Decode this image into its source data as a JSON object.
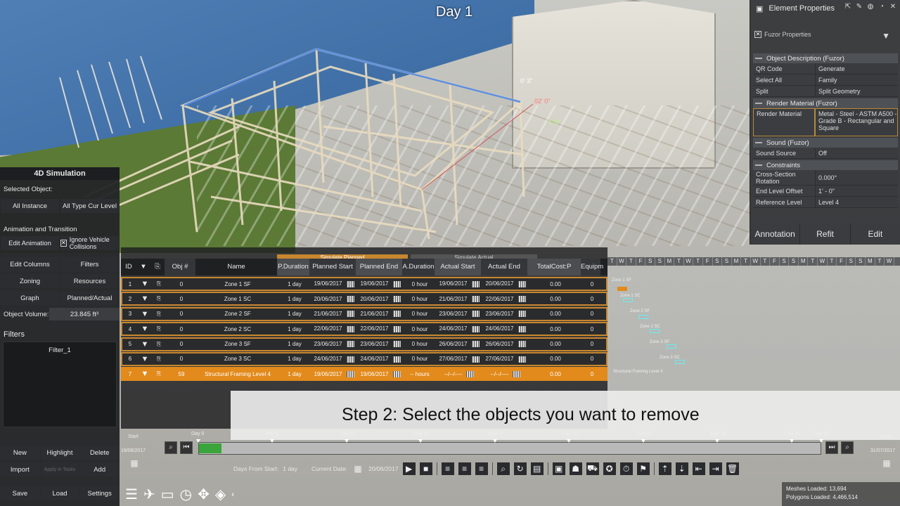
{
  "viewport": {
    "day_label": "Day 1",
    "dims": [
      "0' 3\"",
      "02' 0\"",
      "1' 0\""
    ]
  },
  "props": {
    "title": "Element Properties",
    "fuzor_label": "Fuzor Properties",
    "sections": [
      {
        "title": "Object Description (Fuzor)",
        "rows": [
          {
            "k": "QR Code",
            "v": "Generate"
          },
          {
            "k": "Select All",
            "v": "Family"
          },
          {
            "k": "Split",
            "v": "Split Geometry"
          }
        ]
      },
      {
        "title": "Render Material (Fuzor)",
        "rows": [
          {
            "k": "Render Material",
            "v": "Metal - Steel - ASTM A500 - Grade B - Rectangular and Square"
          }
        ]
      },
      {
        "title": "Sound (Fuzor)",
        "rows": [
          {
            "k": "Sound Source",
            "v": "Off"
          }
        ]
      },
      {
        "title": "Constraints",
        "rows": [
          {
            "k": "Cross-Section Rotation",
            "v": "0.000°"
          },
          {
            "k": "End Level Offset",
            "v": "1' - 0\""
          },
          {
            "k": "Reference Level",
            "v": "Level 4"
          }
        ]
      }
    ],
    "buttons": {
      "annotation": "Annotation",
      "refit": "Refit",
      "edit": "Edit"
    }
  },
  "sim": {
    "title": "4D Simulation",
    "selected_object": "Selected Object:",
    "all_instance": "All Instance",
    "all_type": "All Type Cur Level",
    "anim_transition": "Animation and Transition",
    "edit_animation": "Edit Animation",
    "ignore_vehicle": "Ignore Vehicle Collisions",
    "edit_columns": "Edit Columns",
    "filters_btn": "Filters",
    "zoning": "Zoning",
    "resources": "Resources",
    "graph": "Graph",
    "planned_actual": "Planned/Actual",
    "object_volume_label": "Object Volume:",
    "object_volume_value": "23.845 ft³",
    "filters_heading": "Filters",
    "filter_items": [
      "Filter_1"
    ],
    "new": "New",
    "highlight": "Highlight",
    "delete": "Delete",
    "import": "Import",
    "apply_in_tasks": "Apply in Tasks",
    "add": "Add",
    "save": "Save",
    "load": "Load",
    "settings": "Settings"
  },
  "schedule": {
    "group_planned": "Simulate Planned",
    "group_actual": "Simulate Actual",
    "columns": {
      "id": "ID",
      "obj": "Obj #",
      "name": "Name",
      "p_duration": "P.Duration",
      "planned_start": "Planned Start",
      "planned_end": "Planned End",
      "a_duration": "A.Duration",
      "actual_start": "Actual Start",
      "actual_end": "Actual End",
      "total_cost": "TotalCost:P",
      "equip": "Equipm"
    },
    "rows": [
      {
        "id": "1",
        "obj": "0",
        "name": "Zone 1 SF",
        "pdur": "1 day",
        "ps": "19/06/2017",
        "pe": "19/06/2017",
        "adur": "0 hour",
        "as": "19/06/2017",
        "ae": "20/06/2017",
        "cost": "0.00",
        "eq": "0"
      },
      {
        "id": "2",
        "obj": "0",
        "name": "Zone 1 SC",
        "pdur": "1 day",
        "ps": "20/06/2017",
        "pe": "20/06/2017",
        "adur": "0 hour",
        "as": "21/06/2017",
        "ae": "22/06/2017",
        "cost": "0.00",
        "eq": "0"
      },
      {
        "id": "3",
        "obj": "0",
        "name": "Zone 2 SF",
        "pdur": "1 day",
        "ps": "21/06/2017",
        "pe": "21/06/2017",
        "adur": "0 hour",
        "as": "23/06/2017",
        "ae": "23/06/2017",
        "cost": "0.00",
        "eq": "0"
      },
      {
        "id": "4",
        "obj": "0",
        "name": "Zone 2 SC",
        "pdur": "1 day",
        "ps": "22/06/2017",
        "pe": "22/06/2017",
        "adur": "0 hour",
        "as": "24/06/2017",
        "ae": "24/06/2017",
        "cost": "0.00",
        "eq": "0"
      },
      {
        "id": "5",
        "obj": "0",
        "name": "Zone 3 SF",
        "pdur": "1 day",
        "ps": "23/06/2017",
        "pe": "23/06/2017",
        "adur": "0 hour",
        "as": "26/06/2017",
        "ae": "26/06/2017",
        "cost": "0.00",
        "eq": "0"
      },
      {
        "id": "6",
        "obj": "0",
        "name": "Zone 3 SC",
        "pdur": "1 day",
        "ps": "24/06/2017",
        "pe": "24/06/2017",
        "adur": "0 hour",
        "as": "27/06/2017",
        "ae": "27/06/2017",
        "cost": "0.00",
        "eq": "0"
      },
      {
        "id": "7",
        "obj": "59",
        "name": "Structural Framing Level 4",
        "pdur": "1 day",
        "ps": "19/06/2017",
        "pe": "19/06/2017",
        "adur": "-- hours",
        "as": "--/--/----",
        "ae": "--/--/----",
        "cost": "0.00",
        "eq": "0"
      }
    ]
  },
  "gantt": {
    "days": [
      "T",
      "W",
      "T",
      "F",
      "S",
      "S",
      "M",
      "T",
      "W",
      "T",
      "F",
      "S",
      "S",
      "M",
      "T",
      "W",
      "T",
      "F",
      "S",
      "S",
      "M",
      "T",
      "W",
      "T",
      "F",
      "S",
      "S",
      "M",
      "T",
      "W"
    ],
    "labels": [
      "Zone 1 SF",
      "Zone 1 SC",
      "Zone 2 SF",
      "Zone 2 SC",
      "Zone 3 SF",
      "Zone 3 SC",
      "Structural Framing Level 4"
    ]
  },
  "caption": "Step 2: Select the objects you want to remove",
  "timeline": {
    "start_label": "Start",
    "finish_label": "Finish",
    "start_date": "19/06/2017",
    "end_date": "31/07/2017",
    "ticks": [
      "Day 0",
      "Day 5",
      "Day 10",
      "Day 15",
      "Day 20",
      "Day 25",
      "Day 30",
      "Day 35",
      "Day 40",
      "Day 42"
    ],
    "progress": 0.036,
    "days_from_start_label": "Days From Start:",
    "days_from_start_value": "1 day",
    "current_date_label": "Current Date:",
    "current_date_value": "20/06/2017"
  },
  "stats": {
    "meshes": "Meshes Loaded: 13,694",
    "polygons": "Polygons Loaded: 4,466,514"
  }
}
